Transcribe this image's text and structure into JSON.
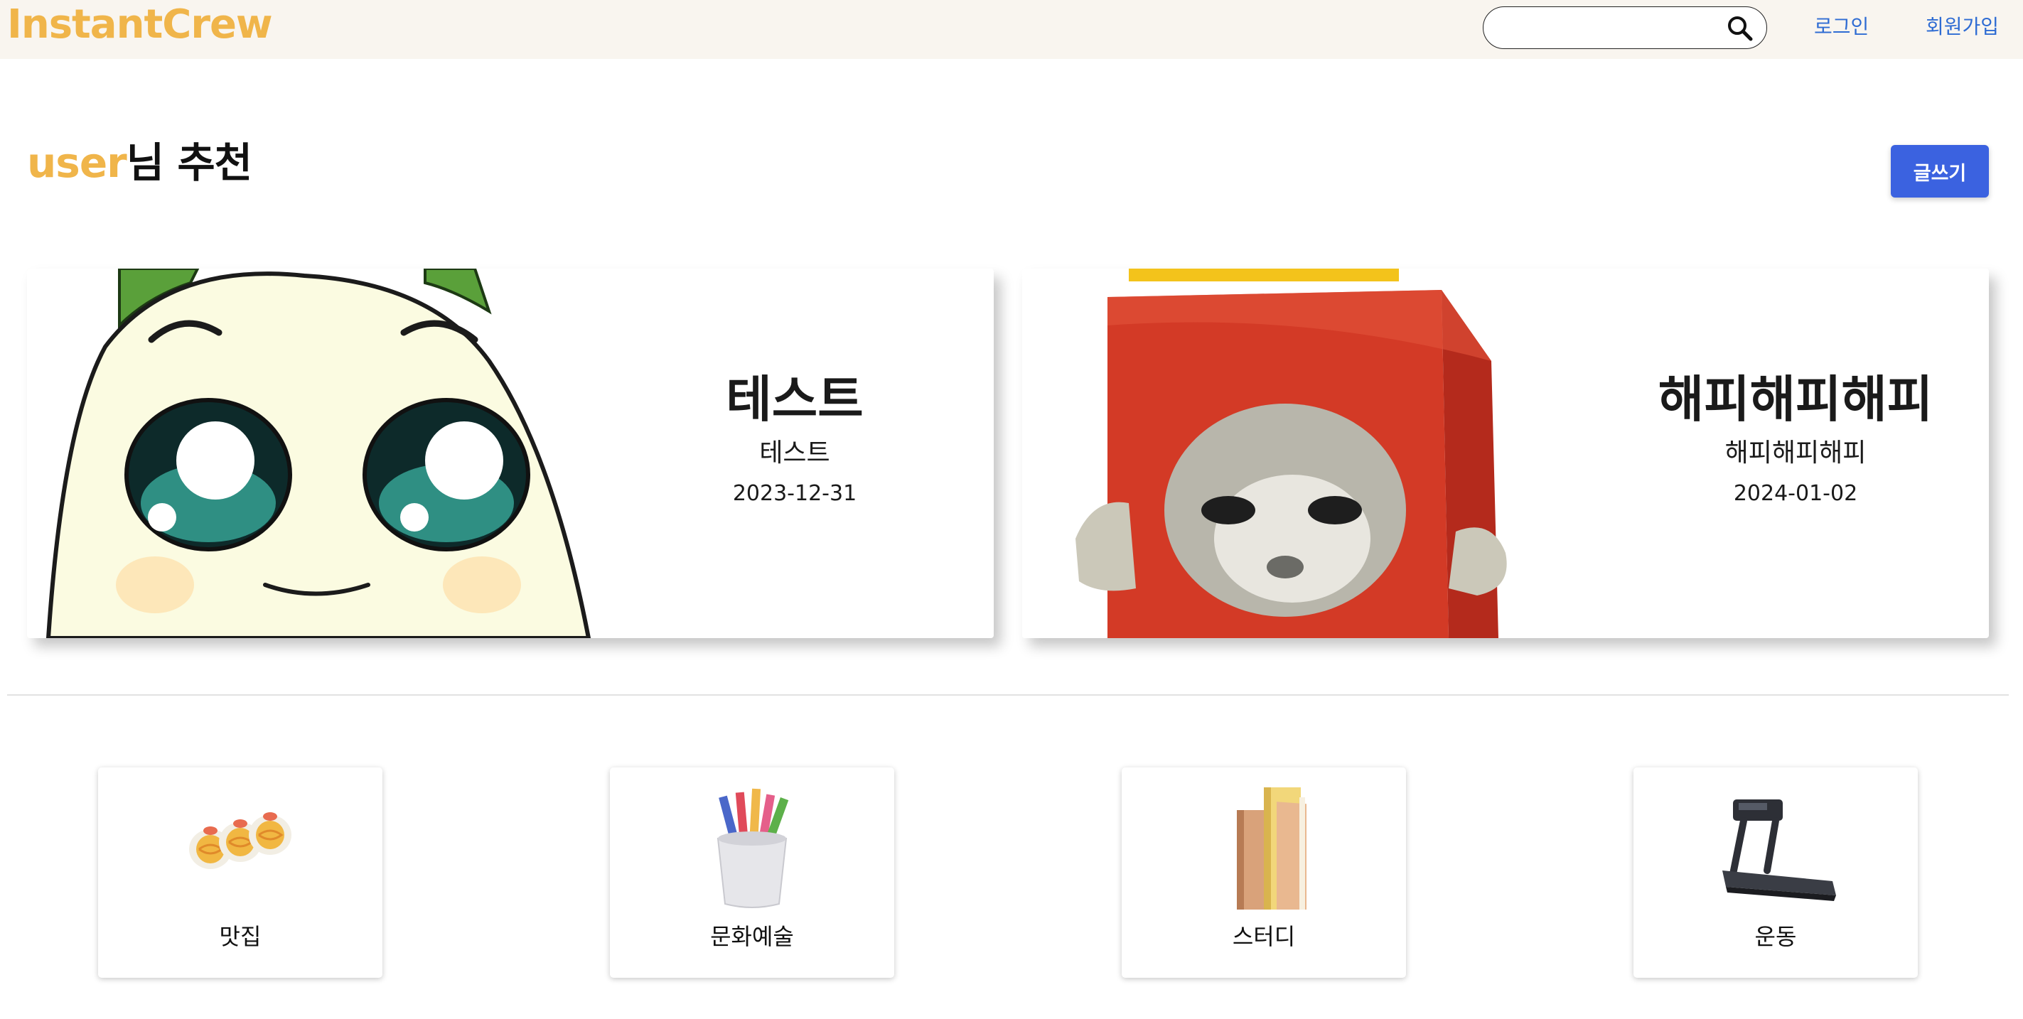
{
  "header": {
    "logo": "InstantCrew",
    "search_placeholder": "",
    "search_icon": "search-icon",
    "login_label": "로그인",
    "signup_label": "회원가입",
    "background_color": "#f9f5ef",
    "logo_color": "#f0b54a",
    "link_color": "#2f6cd3"
  },
  "recommend": {
    "username": "user",
    "title_suffix": "님 추천",
    "write_label": "글쓰기",
    "write_color": "#3b62e0"
  },
  "posts": [
    {
      "title": "테스트",
      "subtitle": "테스트",
      "date": "2023-12-31",
      "image": "cartoon-character-illustration"
    },
    {
      "title": "해피해피해피",
      "subtitle": "해피해피해피",
      "date": "2024-01-02",
      "image": "cat-in-box-photo"
    }
  ],
  "categories": [
    {
      "label": "맛집",
      "icon": "sushi-icon"
    },
    {
      "label": "문화예술",
      "icon": "pencil-cup-icon"
    },
    {
      "label": "스터디",
      "icon": "books-icon"
    },
    {
      "label": "운동",
      "icon": "treadmill-icon"
    }
  ]
}
